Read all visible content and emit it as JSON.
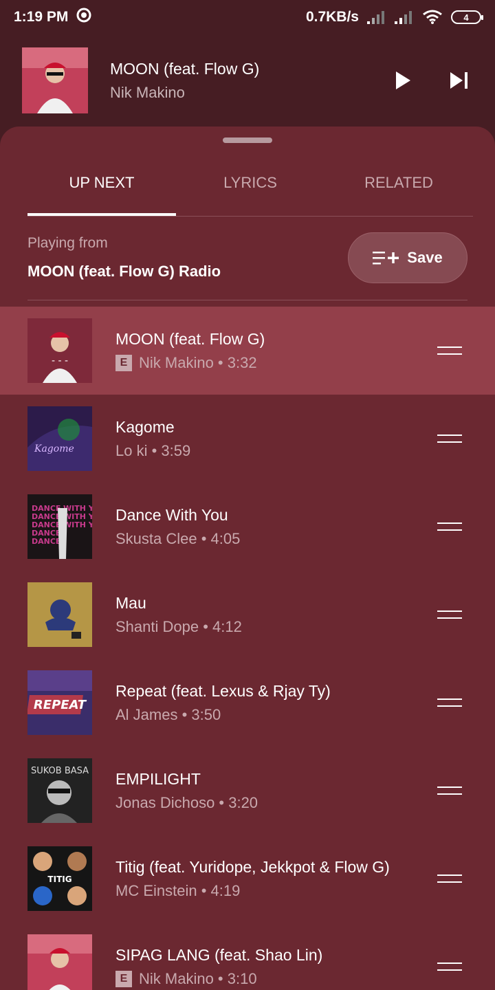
{
  "status": {
    "time": "1:19 PM",
    "network_speed": "0.7KB/s",
    "battery": "4"
  },
  "mini_player": {
    "title": "MOON (feat. Flow G)",
    "artist": "Nik Makino",
    "play_icon": "play-icon",
    "next_icon": "skip-next-icon"
  },
  "tabs": [
    {
      "label": "UP NEXT",
      "active": true
    },
    {
      "label": "LYRICS",
      "active": false
    },
    {
      "label": "RELATED",
      "active": false
    }
  ],
  "playing_from": {
    "label": "Playing from",
    "source": "MOON (feat. Flow G) Radio"
  },
  "save_button": {
    "label": "Save",
    "icon": "playlist-add-icon"
  },
  "queue": [
    {
      "title": "MOON (feat. Flow G)",
      "subtitle": "Nik Makino • 3:32",
      "explicit": "E",
      "current": true,
      "art_color": "#c2405a"
    },
    {
      "title": "Kagome",
      "subtitle": "Lo ki • 3:59",
      "explicit": "",
      "current": false,
      "art_color": "#2c1b4a"
    },
    {
      "title": "Dance With You",
      "subtitle": "Skusta Clee • 4:05",
      "explicit": "",
      "current": false,
      "art_color": "#1a1416"
    },
    {
      "title": "Mau",
      "subtitle": "Shanti Dope • 4:12",
      "explicit": "",
      "current": false,
      "art_color": "#a88a3a"
    },
    {
      "title": "Repeat (feat. Lexus & Rjay Ty)",
      "subtitle": "Al James • 3:50",
      "explicit": "",
      "current": false,
      "art_color": "#3a2d6a"
    },
    {
      "title": "EMPILIGHT",
      "subtitle": "Jonas Dichoso • 3:20",
      "explicit": "",
      "current": false,
      "art_color": "#222222"
    },
    {
      "title": "Titig (feat. Yuridope, Jekkpot & Flow G)",
      "subtitle": "MC Einstein • 4:19",
      "explicit": "",
      "current": false,
      "art_color": "#151515"
    },
    {
      "title": "SIPAG LANG (feat. Shao Lin)",
      "subtitle": "Nik Makino • 3:10",
      "explicit": "E",
      "current": false,
      "art_color": "#c2405a"
    }
  ]
}
